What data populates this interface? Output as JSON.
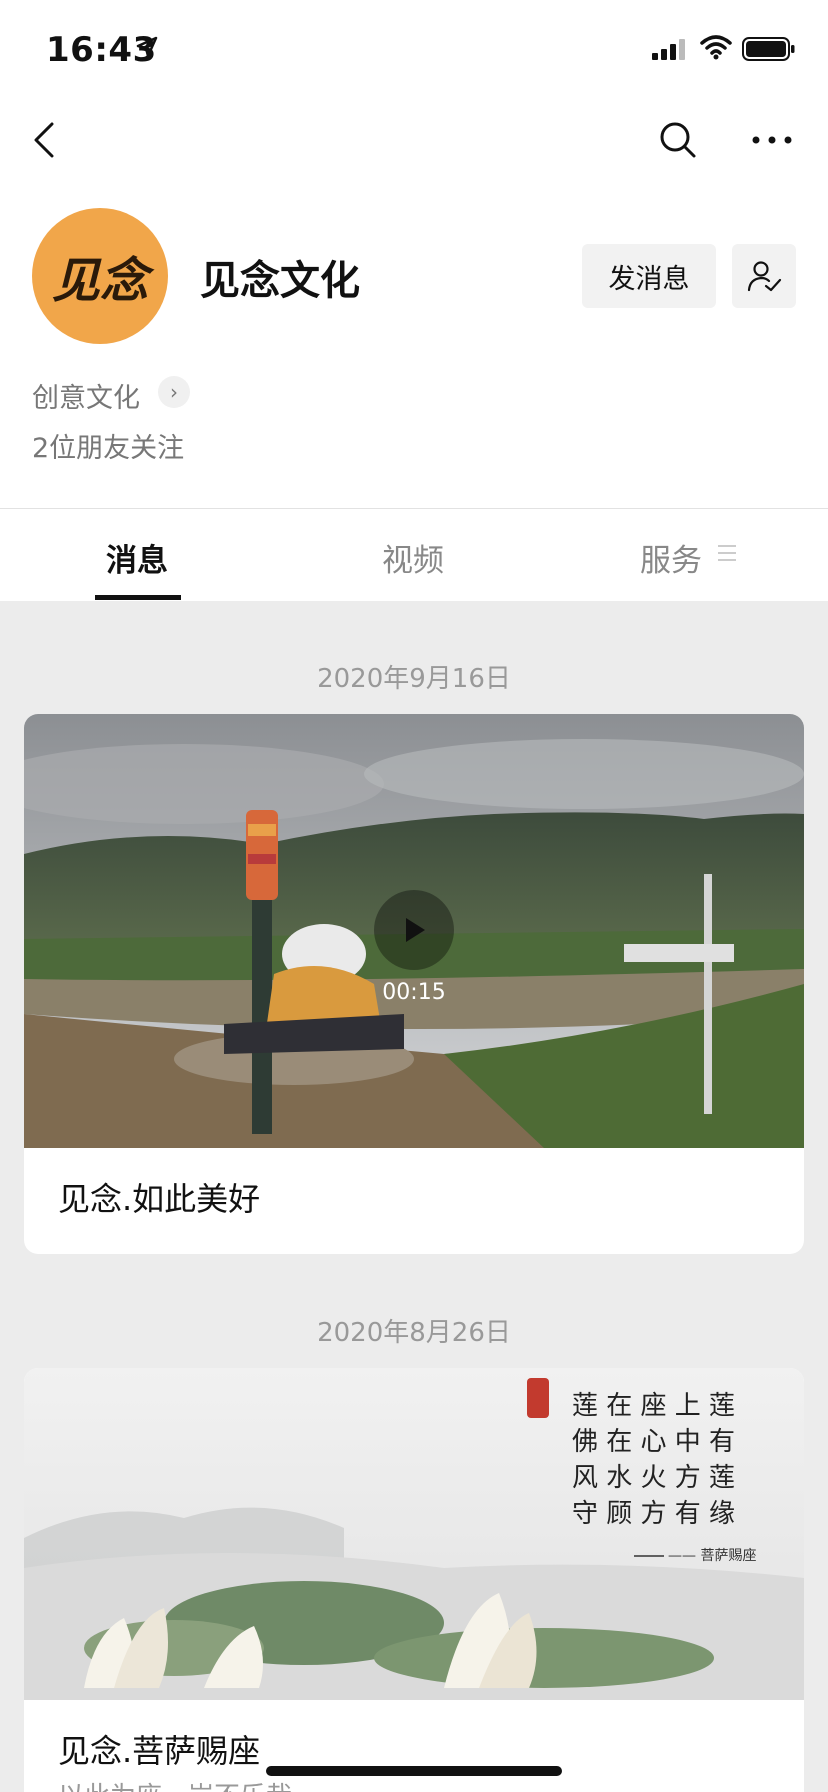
{
  "status": {
    "time": "16:43"
  },
  "account": {
    "avatar_text": "见念",
    "name": "见念文化",
    "send_message_label": "发消息",
    "category": "创意文化",
    "friends_following": "2位朋友关注"
  },
  "tabs": [
    {
      "label": "消息",
      "active": true
    },
    {
      "label": "视频",
      "active": false
    },
    {
      "label": "服务",
      "active": false
    }
  ],
  "posts": [
    {
      "date": "2020年9月16日",
      "title": "见念.如此美好",
      "duration": "00:15",
      "type": "video"
    },
    {
      "date": "2020年8月26日",
      "title": "见念.菩萨赐座",
      "subtitle": "以此为座，岂不乐哉",
      "type": "article",
      "image_text": "莲 在 座 上 莲\n佛 在 心 中 有\n风 水 火 方 莲\n守 顾 方 有 缘",
      "image_sign": "—— 菩萨赐座"
    }
  ],
  "colors": {
    "avatar_bg": "#f1a64a",
    "feed_bg": "#ececec",
    "tab_active": "#111111"
  }
}
